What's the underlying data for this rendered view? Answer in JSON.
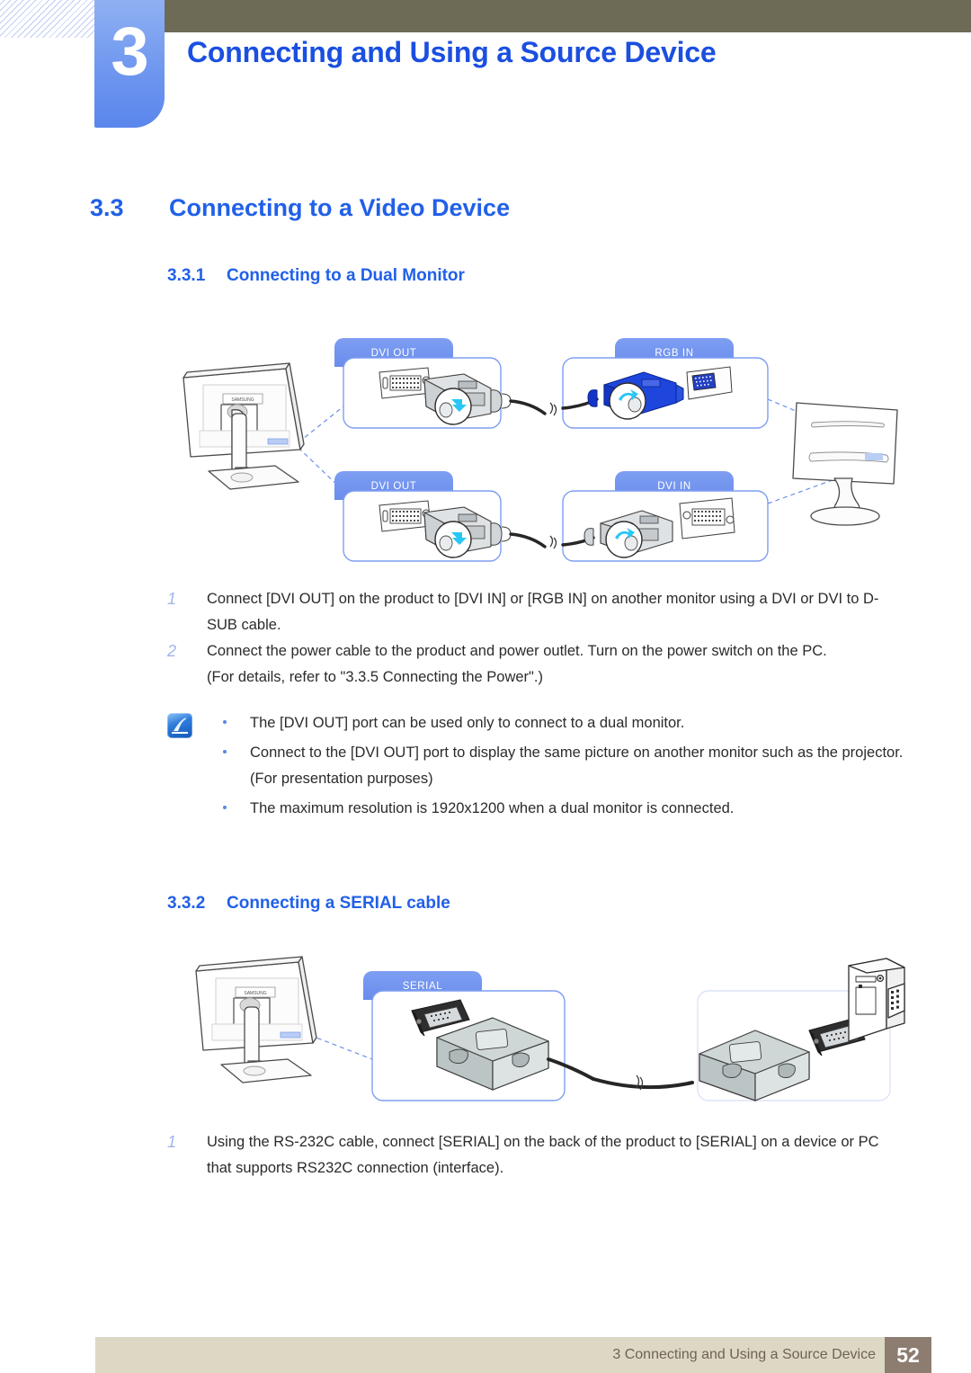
{
  "header": {
    "chapter_number": "3",
    "chapter_title": "Connecting and Using a Source Device"
  },
  "section": {
    "number": "3.3",
    "title": "Connecting to a Video Device"
  },
  "subsections": [
    {
      "number": "3.3.1",
      "title": "Connecting to a Dual Monitor"
    },
    {
      "number": "3.3.2",
      "title": "Connecting a SERIAL cable"
    }
  ],
  "dual_monitor": {
    "figure_labels": {
      "dvi_out_top": "DVI OUT",
      "dvi_out_bottom": "DVI OUT",
      "rgb_in": "RGB IN",
      "dvi_in": "DVI IN",
      "monitor_brand": "SAMSUNG"
    },
    "steps": [
      {
        "index": "1",
        "text": "Connect [DVI OUT] on the product to [DVI IN] or [RGB IN] on another monitor using a DVI or DVI to D-SUB cable."
      },
      {
        "index": "2",
        "text": "Connect the power cable to the product and power outlet. Turn on the power switch on the PC.",
        "sub": "(For details, refer to \"3.3.5    Connecting the Power\".)"
      }
    ],
    "notes": [
      {
        "text": "The [DVI OUT] port can be used only to connect to a dual monitor."
      },
      {
        "text": "Connect to the [DVI OUT] port to display the same picture on another monitor such as the projector.",
        "cont": "(For presentation purposes)"
      },
      {
        "text": "The maximum resolution is 1920x1200 when a dual monitor is connected."
      }
    ]
  },
  "serial": {
    "figure_labels": {
      "serial": "SERIAL",
      "monitor_brand": "SAMSUNG"
    },
    "steps": [
      {
        "index": "1",
        "text": "Using the RS-232C cable, connect [SERIAL] on the back of the product to [SERIAL] on a device or PC that supports RS232C connection (interface)."
      }
    ]
  },
  "footer": {
    "text": "3 Connecting and Using a Source Device",
    "page": "52"
  },
  "colors": {
    "heading_blue": "#2160e8",
    "tab_blue": "#6f97ef",
    "olive": "#6d6a56",
    "footer_bar": "#ddd8c4",
    "footer_page_box": "#8d7d71",
    "connector_blue": "#1434c8"
  }
}
